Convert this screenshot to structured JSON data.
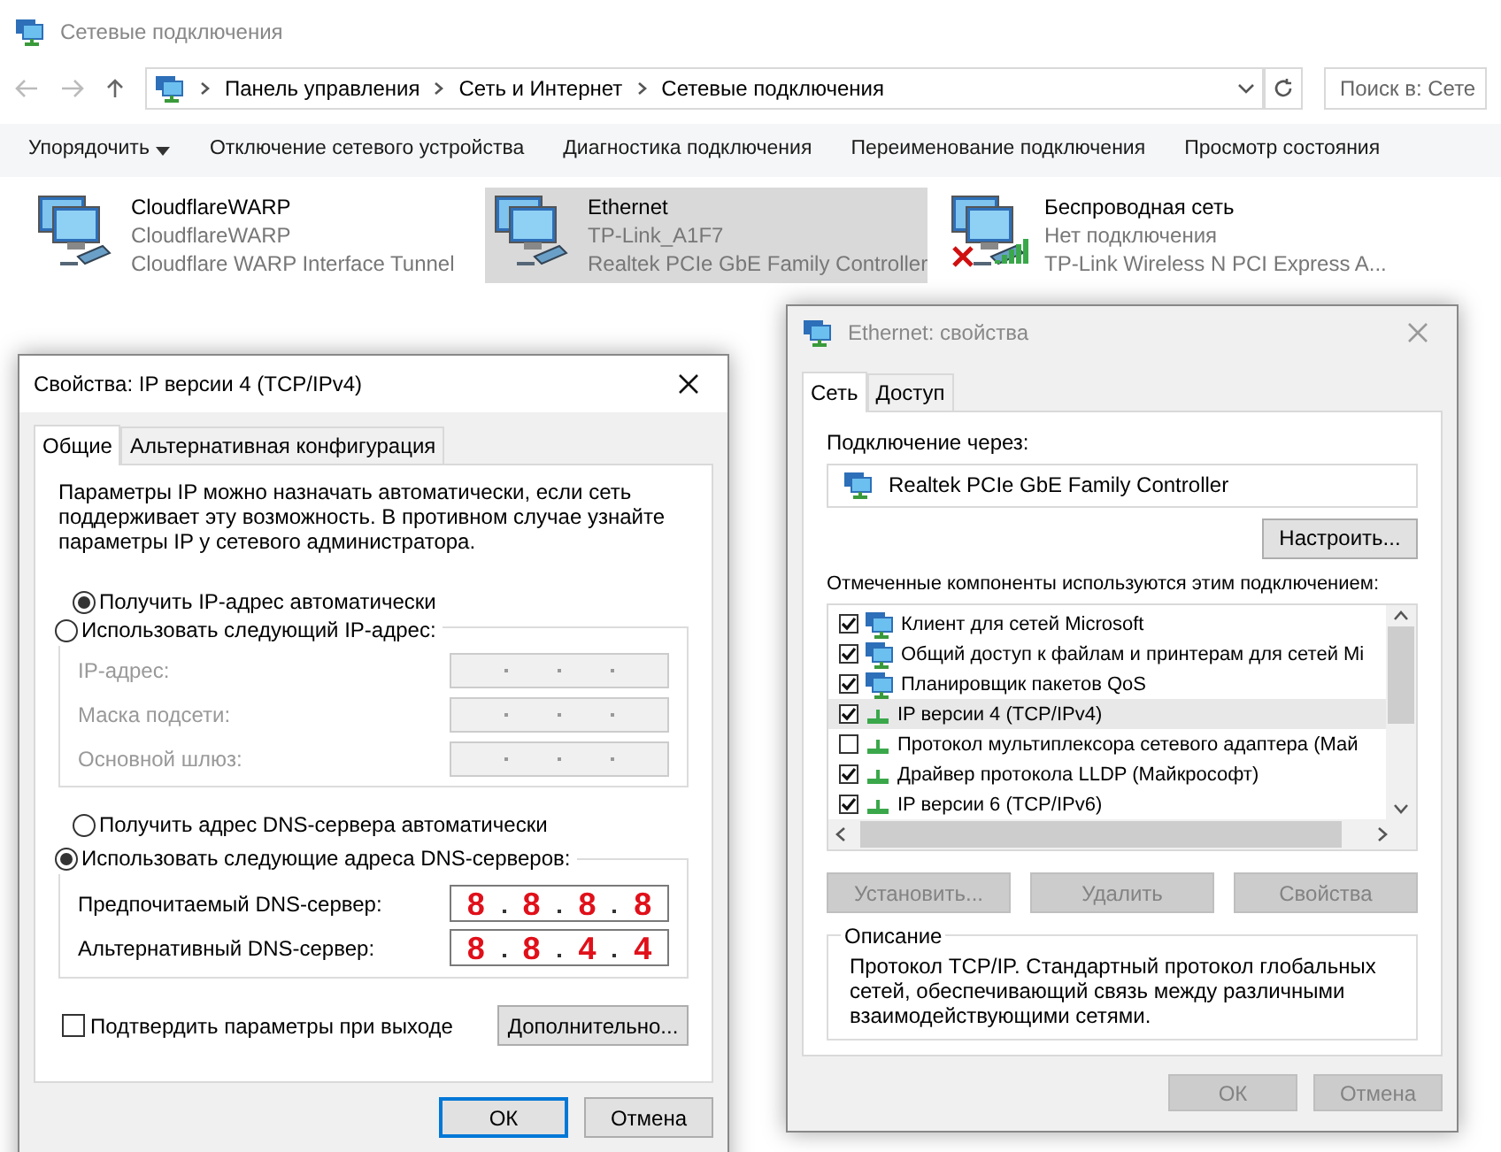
{
  "window": {
    "title": "Сетевые подключения"
  },
  "address_bar": {
    "breadcrumb": [
      "Панель управления",
      "Сеть и Интернет",
      "Сетевые подключения"
    ],
    "search_placeholder": "Поиск в: Сете"
  },
  "toolbar": [
    {
      "label": "Упорядочить",
      "kind": "menu"
    },
    {
      "label": "Отключение сетевого устройства",
      "kind": "button"
    },
    {
      "label": "Диагностика подключения",
      "kind": "button"
    },
    {
      "label": "Переименование подключения",
      "kind": "button"
    },
    {
      "label": "Просмотр состояния",
      "kind": "button"
    }
  ],
  "adapters": [
    {
      "name": "CloudflareWARP",
      "status": "CloudflareWARP",
      "device": "Cloudflare WARP Interface Tunnel",
      "kind": "wired",
      "selected": false
    },
    {
      "name": "Ethernet",
      "status": "TP-Link_A1F7",
      "device": "Realtek PCIe GbE Family Controller",
      "kind": "wired",
      "selected": true
    },
    {
      "name": "Беспроводная сеть",
      "status": "Нет подключения",
      "device": "TP-Link Wireless N PCI Express A...",
      "kind": "wireless",
      "selected": false
    }
  ],
  "ipv4_dialog": {
    "title": "Свойства: IP версии 4 (TCP/IPv4)",
    "tabs": [
      {
        "label": "Общие",
        "selected": true
      },
      {
        "label": "Альтернативная конфигурация",
        "selected": false
      }
    ],
    "description": "Параметры IP можно назначать автоматически, если сеть поддерживает эту возможность. В противном случае узнайте параметры IP у сетевого администратора.",
    "ip_modes": [
      {
        "label": "Получить IP-адрес автоматически",
        "selected": true
      },
      {
        "label": "Использовать следующий IP-адрес:",
        "selected": false
      }
    ],
    "ip_fields": [
      {
        "label": "IP-адрес:",
        "disabled": true
      },
      {
        "label": "Маска подсети:",
        "disabled": true
      },
      {
        "label": "Основной шлюз:",
        "disabled": true
      }
    ],
    "dns_modes": [
      {
        "label": "Получить адрес DNS-сервера автоматически",
        "selected": false
      },
      {
        "label": "Использовать следующие адреса DNS-серверов:",
        "selected": true
      }
    ],
    "dns_fields": [
      {
        "label": "Предпочитаемый DNS-сервер:",
        "value": [
          "8",
          "8",
          "8",
          "8"
        ]
      },
      {
        "label": "Альтернативный DNS-сервер:",
        "value": [
          "8",
          "8",
          "4",
          "4"
        ]
      }
    ],
    "validate": {
      "label": "Подтвердить параметры при выходе",
      "checked": false
    },
    "advanced_button": "Дополнительно...",
    "buttons": [
      {
        "label": "ОК",
        "default": true
      },
      {
        "label": "Отмена",
        "default": false
      }
    ]
  },
  "ethernet_dialog": {
    "title": "Ethernet: свойства",
    "tabs": [
      {
        "label": "Сеть",
        "selected": true
      },
      {
        "label": "Доступ",
        "selected": false
      }
    ],
    "connect_via_label": "Подключение через:",
    "adapter": "Realtek PCIe GbE Family Controller",
    "configure_button": "Настроить...",
    "components_label": "Отмеченные компоненты используются этим подключением:",
    "components": [
      {
        "label": "Клиент для сетей Microsoft",
        "checked": true,
        "selected": false,
        "kind": "client"
      },
      {
        "label": "Общий доступ к файлам и принтерам для сетей Mi",
        "checked": true,
        "selected": false,
        "kind": "service"
      },
      {
        "label": "Планировщик пакетов QoS",
        "checked": true,
        "selected": false,
        "kind": "service"
      },
      {
        "label": "IP версии 4 (TCP/IPv4)",
        "checked": true,
        "selected": true,
        "kind": "protocol"
      },
      {
        "label": "Протокол мультиплексора сетевого адаптера (Май",
        "checked": false,
        "selected": false,
        "kind": "protocol"
      },
      {
        "label": "Драйвер протокола LLDP (Майкрософт)",
        "checked": true,
        "selected": false,
        "kind": "protocol"
      },
      {
        "label": "IP версии 6 (TCP/IPv6)",
        "checked": true,
        "selected": false,
        "kind": "protocol"
      }
    ],
    "actions": [
      {
        "label": "Установить...",
        "disabled": true
      },
      {
        "label": "Удалить",
        "disabled": true
      },
      {
        "label": "Свойства",
        "disabled": true
      }
    ],
    "description_title": "Описание",
    "description": "Протокол TCP/IP. Стандартный протокол глобальных сетей, обеспечивающий связь между различными взаимодействующими сетями.",
    "buttons": [
      {
        "label": "ОК",
        "disabled": true
      },
      {
        "label": "Отмена",
        "disabled": true
      }
    ]
  }
}
